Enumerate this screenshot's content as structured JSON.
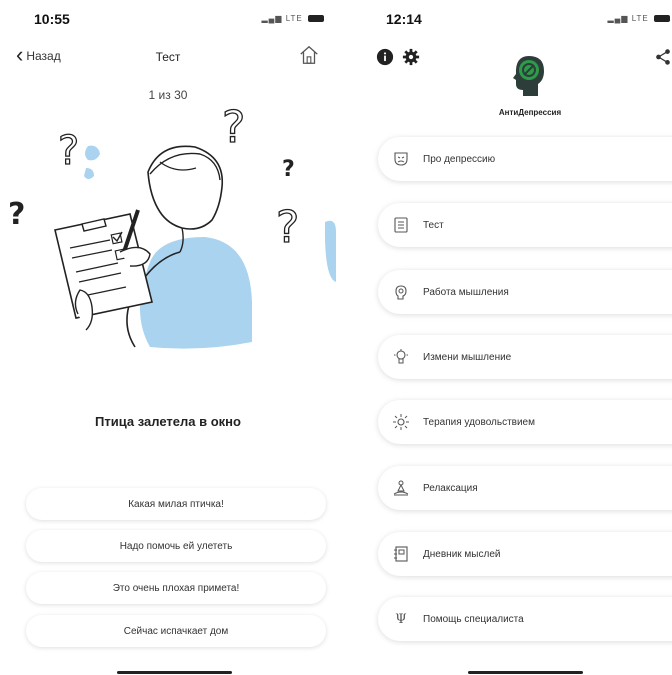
{
  "left": {
    "status": {
      "time": "10:55",
      "network": "LTE"
    },
    "nav": {
      "back_label": "Назад",
      "title": "Тест"
    },
    "progress": "1 из 30",
    "question": "Птица залетела в окно",
    "answers": [
      "Какая милая птичка!",
      "Надо помочь ей улететь",
      "Это очень плохая примета!",
      "Сейчас испачкает дом"
    ]
  },
  "right": {
    "status": {
      "time": "12:14",
      "network": "LTE"
    },
    "app_name": "АнтиДепрессия",
    "menu": [
      {
        "label": "Про депрессию",
        "icon": "mask-icon"
      },
      {
        "label": "Тест",
        "icon": "checklist-icon"
      },
      {
        "label": "Работа мышления",
        "icon": "brain-gear-icon"
      },
      {
        "label": "Измени мышление",
        "icon": "lightbulb-icon"
      },
      {
        "label": "Терапия удовольствием",
        "icon": "sun-icon"
      },
      {
        "label": "Релаксация",
        "icon": "meditation-icon"
      },
      {
        "label": "Дневник мыслей",
        "icon": "notebook-icon"
      },
      {
        "label": "Помощь специалиста",
        "icon": "psi-icon"
      }
    ]
  },
  "colors": {
    "illustration_accent": "#a9d3ee",
    "logo_green": "#2e9b4a",
    "logo_dark": "#2d3e3a",
    "text": "#333333"
  }
}
